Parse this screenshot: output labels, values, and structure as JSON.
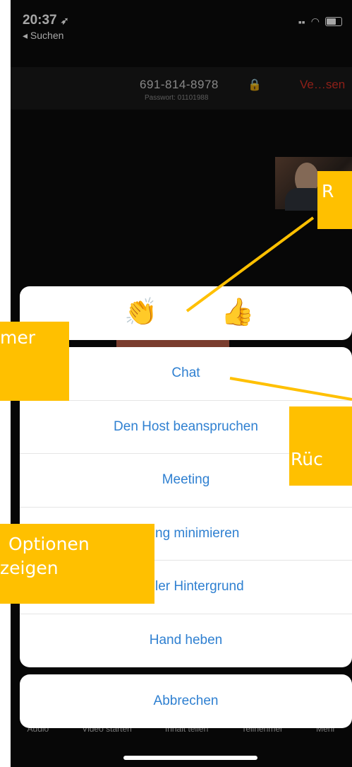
{
  "status_bar": {
    "time": "20:37",
    "location_icon": "location-arrow-icon",
    "back_label": "Suchen"
  },
  "meeting": {
    "id": "691-814-8978",
    "password": "Passwort: 01101988",
    "leave_label": "Ve…sen"
  },
  "reactions": [
    {
      "name": "clapping-hands",
      "glyph": "👏"
    },
    {
      "name": "thumbs-up",
      "glyph": "👍"
    }
  ],
  "menu": {
    "items": [
      "Chat",
      "Den Host beanspruchen",
      "Meeting",
      "Meeting minimieren",
      "Virtueller Hintergrund",
      "Hand heben"
    ],
    "visible_labels": [
      "Chat",
      "Den Host beanspruchen",
      "Meeting",
      "ng minimieren",
      "ler Hintergrund",
      "Hand heben"
    ],
    "cancel": "Abbrechen"
  },
  "toolbar_labels": [
    "Audio",
    "Video starten",
    "Inhalt teilen",
    "Teilnehmer",
    "Mehr"
  ],
  "callouts": {
    "top_right": "R",
    "left": "mer",
    "right": "Rüc",
    "options_line1": "Optionen",
    "options_line2": "zeigen"
  },
  "colors": {
    "accent": "#2f80d1",
    "callout": "#ffc000",
    "leave": "#d93025"
  }
}
